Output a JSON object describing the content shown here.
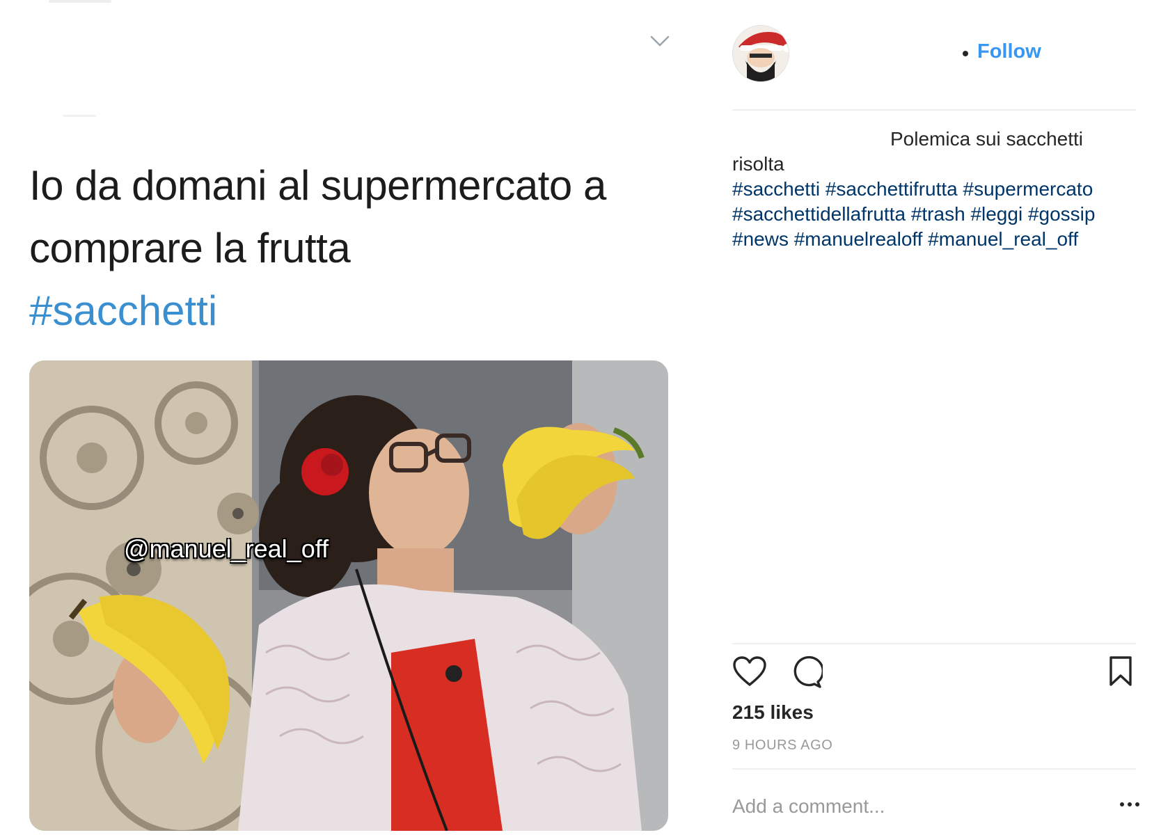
{
  "tweet": {
    "text": "Io da domani al supermercato a comprare la frutta",
    "hashtag": "#sacchetti",
    "media": {
      "watermark": "@manuel_real_off"
    }
  },
  "post": {
    "follow_label": "Follow",
    "caption": {
      "line1": "Polemica sui sacchetti",
      "line2": "risolta",
      "hashtags": [
        "#sacchetti",
        "#sacchettifrutta",
        "#supermercato",
        "#sacchettidellafrutta",
        "#trash",
        "#leggi",
        "#gossip",
        "#news",
        "#manuelrealoff",
        "#manuel_real_off"
      ]
    },
    "actions": {
      "like_icon": "heart-icon",
      "comment_icon": "comment-icon",
      "save_icon": "bookmark-icon"
    },
    "likes": "215 likes",
    "time_ago": "9 HOURS AGO",
    "comment_placeholder": "Add a comment...",
    "more_icon": "more-options-icon"
  },
  "colors": {
    "link": "#3897f0",
    "hashtag_tweet": "#3a8fd0",
    "hashtag_caption": "#003569",
    "muted": "#999999"
  }
}
